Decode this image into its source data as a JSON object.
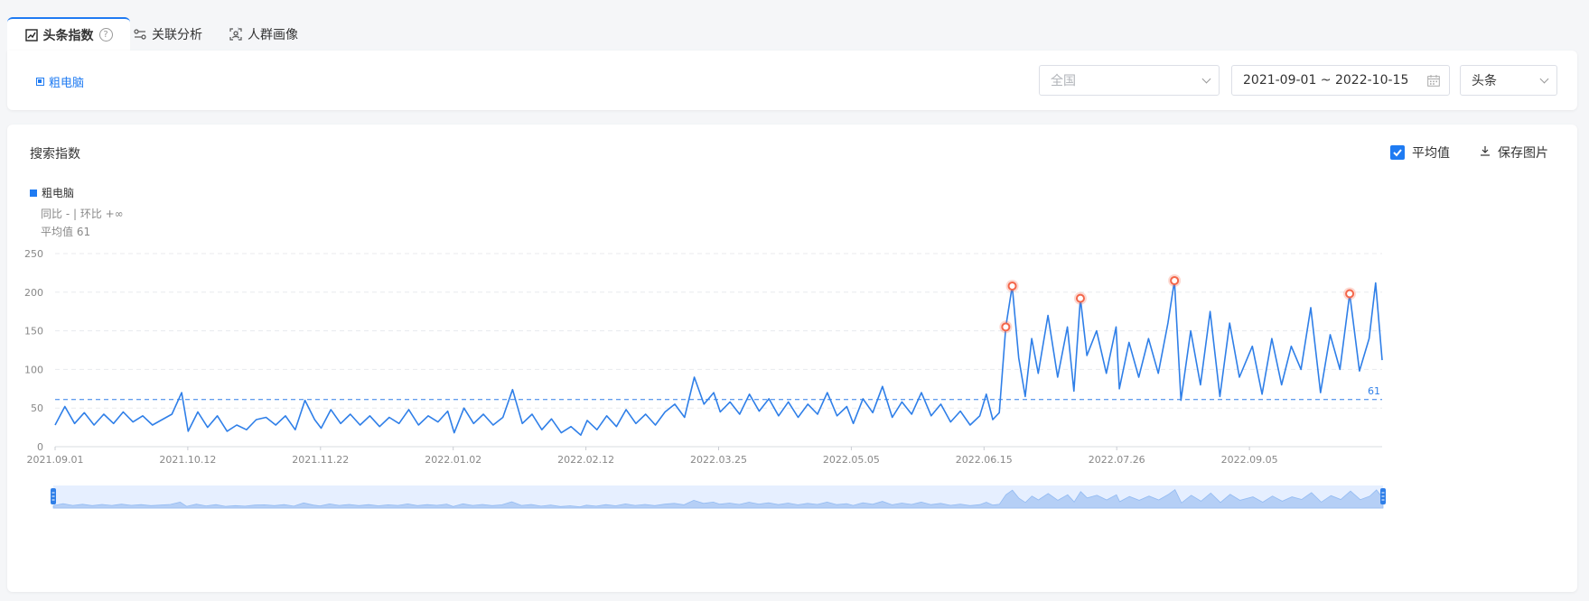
{
  "tabs": [
    {
      "label": "头条指数",
      "active": true,
      "icon": "trend-chart-icon"
    },
    {
      "label": "关联分析",
      "active": false,
      "icon": "link-analysis-icon"
    },
    {
      "label": "人群画像",
      "active": false,
      "icon": "user-portrait-icon"
    }
  ],
  "help_icon": "?",
  "filter": {
    "keyword": "粗电脑",
    "region_placeholder": "全国",
    "date_range": "2021-09-01 ~ 2022-10-15",
    "platform": "头条"
  },
  "chart_panel": {
    "title": "搜索指数",
    "average_toggle_label": "平均值",
    "average_toggle_checked": true,
    "save_label": "保存图片",
    "legend_label": "粗电脑",
    "yoy_mom_text": "同比 - | 环比 +∞",
    "average_text": "平均值 61"
  },
  "colors": {
    "accent": "#1f7bf2",
    "line": "#2f7fe8",
    "highlight_marker": "#f4664a"
  },
  "chart_data": {
    "type": "line",
    "title": "",
    "xlabel": "",
    "ylabel": "",
    "ylim": [
      0,
      250
    ],
    "yticks": [
      0,
      50,
      100,
      150,
      200,
      250
    ],
    "grid": true,
    "x_start": "2021-09-01",
    "x_end": "2022-10-15",
    "x_tick_labels": [
      "2021.09.01",
      "2021.10.12",
      "2021.11.22",
      "2022.01.02",
      "2022.02.12",
      "2022.03.25",
      "2022.05.05",
      "2022.06.15",
      "2022.07.26",
      "2022.09.05"
    ],
    "average": 61,
    "average_label": "61",
    "series": [
      {
        "name": "粗电脑",
        "points": [
          [
            "2021-09-01",
            28
          ],
          [
            "2021-09-04",
            52
          ],
          [
            "2021-09-07",
            30
          ],
          [
            "2021-09-10",
            44
          ],
          [
            "2021-09-13",
            28
          ],
          [
            "2021-09-16",
            42
          ],
          [
            "2021-09-19",
            30
          ],
          [
            "2021-09-22",
            45
          ],
          [
            "2021-09-25",
            32
          ],
          [
            "2021-09-28",
            40
          ],
          [
            "2021-10-01",
            28
          ],
          [
            "2021-10-04",
            35
          ],
          [
            "2021-10-07",
            42
          ],
          [
            "2021-10-10",
            70
          ],
          [
            "2021-10-12",
            20
          ],
          [
            "2021-10-15",
            45
          ],
          [
            "2021-10-18",
            25
          ],
          [
            "2021-10-21",
            40
          ],
          [
            "2021-10-24",
            20
          ],
          [
            "2021-10-27",
            28
          ],
          [
            "2021-10-30",
            22
          ],
          [
            "2021-11-02",
            35
          ],
          [
            "2021-11-05",
            38
          ],
          [
            "2021-11-08",
            28
          ],
          [
            "2021-11-11",
            40
          ],
          [
            "2021-11-14",
            22
          ],
          [
            "2021-11-17",
            60
          ],
          [
            "2021-11-20",
            35
          ],
          [
            "2021-11-22",
            24
          ],
          [
            "2021-11-25",
            48
          ],
          [
            "2021-11-28",
            30
          ],
          [
            "2021-12-01",
            42
          ],
          [
            "2021-12-04",
            28
          ],
          [
            "2021-12-07",
            40
          ],
          [
            "2021-12-10",
            26
          ],
          [
            "2021-12-13",
            38
          ],
          [
            "2021-12-16",
            30
          ],
          [
            "2021-12-19",
            48
          ],
          [
            "2021-12-22",
            28
          ],
          [
            "2021-12-25",
            40
          ],
          [
            "2021-12-28",
            32
          ],
          [
            "2021-12-31",
            46
          ],
          [
            "2022-01-02",
            18
          ],
          [
            "2022-01-05",
            50
          ],
          [
            "2022-01-08",
            30
          ],
          [
            "2022-01-11",
            42
          ],
          [
            "2022-01-14",
            28
          ],
          [
            "2022-01-17",
            38
          ],
          [
            "2022-01-20",
            74
          ],
          [
            "2022-01-23",
            30
          ],
          [
            "2022-01-26",
            42
          ],
          [
            "2022-01-29",
            22
          ],
          [
            "2022-02-01",
            36
          ],
          [
            "2022-02-04",
            18
          ],
          [
            "2022-02-07",
            26
          ],
          [
            "2022-02-10",
            15
          ],
          [
            "2022-02-12",
            34
          ],
          [
            "2022-02-15",
            22
          ],
          [
            "2022-02-18",
            40
          ],
          [
            "2022-02-21",
            26
          ],
          [
            "2022-02-24",
            48
          ],
          [
            "2022-02-27",
            30
          ],
          [
            "2022-03-02",
            42
          ],
          [
            "2022-03-05",
            28
          ],
          [
            "2022-03-08",
            45
          ],
          [
            "2022-03-11",
            55
          ],
          [
            "2022-03-14",
            38
          ],
          [
            "2022-03-17",
            90
          ],
          [
            "2022-03-20",
            55
          ],
          [
            "2022-03-23",
            70
          ],
          [
            "2022-03-25",
            45
          ],
          [
            "2022-03-28",
            58
          ],
          [
            "2022-03-31",
            42
          ],
          [
            "2022-04-03",
            68
          ],
          [
            "2022-04-06",
            46
          ],
          [
            "2022-04-09",
            62
          ],
          [
            "2022-04-12",
            40
          ],
          [
            "2022-04-15",
            58
          ],
          [
            "2022-04-18",
            38
          ],
          [
            "2022-04-21",
            55
          ],
          [
            "2022-04-24",
            42
          ],
          [
            "2022-04-27",
            70
          ],
          [
            "2022-04-30",
            40
          ],
          [
            "2022-05-03",
            52
          ],
          [
            "2022-05-05",
            30
          ],
          [
            "2022-05-08",
            62
          ],
          [
            "2022-05-11",
            44
          ],
          [
            "2022-05-14",
            78
          ],
          [
            "2022-05-17",
            38
          ],
          [
            "2022-05-20",
            58
          ],
          [
            "2022-05-23",
            42
          ],
          [
            "2022-05-26",
            70
          ],
          [
            "2022-05-29",
            40
          ],
          [
            "2022-06-01",
            55
          ],
          [
            "2022-06-04",
            32
          ],
          [
            "2022-06-07",
            46
          ],
          [
            "2022-06-10",
            28
          ],
          [
            "2022-06-13",
            40
          ],
          [
            "2022-06-15",
            68
          ],
          [
            "2022-06-17",
            35
          ],
          [
            "2022-06-19",
            44
          ],
          [
            "2022-06-21",
            155
          ],
          [
            "2022-06-23",
            208
          ],
          [
            "2022-06-25",
            115
          ],
          [
            "2022-06-27",
            65
          ],
          [
            "2022-06-29",
            140
          ],
          [
            "2022-07-01",
            95
          ],
          [
            "2022-07-04",
            170
          ],
          [
            "2022-07-07",
            90
          ],
          [
            "2022-07-10",
            155
          ],
          [
            "2022-07-12",
            72
          ],
          [
            "2022-07-14",
            192
          ],
          [
            "2022-07-16",
            118
          ],
          [
            "2022-07-19",
            150
          ],
          [
            "2022-07-22",
            95
          ],
          [
            "2022-07-25",
            155
          ],
          [
            "2022-07-26",
            75
          ],
          [
            "2022-07-29",
            135
          ],
          [
            "2022-08-01",
            90
          ],
          [
            "2022-08-04",
            140
          ],
          [
            "2022-08-07",
            95
          ],
          [
            "2022-08-10",
            160
          ],
          [
            "2022-08-12",
            215
          ],
          [
            "2022-08-14",
            60
          ],
          [
            "2022-08-17",
            150
          ],
          [
            "2022-08-20",
            80
          ],
          [
            "2022-08-23",
            175
          ],
          [
            "2022-08-26",
            65
          ],
          [
            "2022-08-29",
            160
          ],
          [
            "2022-09-01",
            90
          ],
          [
            "2022-09-05",
            130
          ],
          [
            "2022-09-08",
            68
          ],
          [
            "2022-09-11",
            140
          ],
          [
            "2022-09-14",
            80
          ],
          [
            "2022-09-17",
            130
          ],
          [
            "2022-09-20",
            100
          ],
          [
            "2022-09-23",
            180
          ],
          [
            "2022-09-26",
            70
          ],
          [
            "2022-09-29",
            145
          ],
          [
            "2022-10-02",
            100
          ],
          [
            "2022-10-05",
            198
          ],
          [
            "2022-10-08",
            98
          ],
          [
            "2022-10-11",
            140
          ],
          [
            "2022-10-13",
            212
          ],
          [
            "2022-10-15",
            112
          ]
        ]
      }
    ],
    "highlighted_points": [
      [
        "2022-06-21",
        155
      ],
      [
        "2022-06-23",
        208
      ],
      [
        "2022-07-14",
        192
      ],
      [
        "2022-08-12",
        215
      ],
      [
        "2022-10-05",
        198
      ]
    ]
  }
}
